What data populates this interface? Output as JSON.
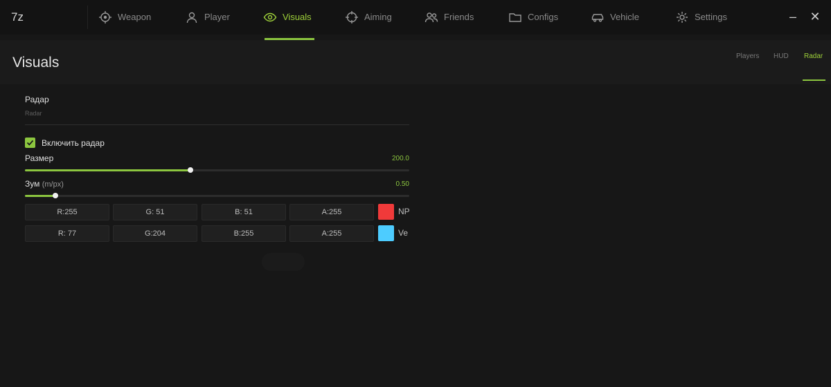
{
  "app": {
    "logo": "7z"
  },
  "nav": {
    "items": [
      {
        "label": "Weapon",
        "icon": "crosshair-target-icon"
      },
      {
        "label": "Player",
        "icon": "user-icon"
      },
      {
        "label": "Visuals",
        "icon": "eye-icon"
      },
      {
        "label": "Aiming",
        "icon": "crosshair-icon"
      },
      {
        "label": "Friends",
        "icon": "users-icon"
      },
      {
        "label": "Configs",
        "icon": "folder-icon"
      },
      {
        "label": "Vehicle",
        "icon": "car-icon"
      },
      {
        "label": "Settings",
        "icon": "gear-icon"
      }
    ],
    "active": "Visuals"
  },
  "window": {
    "minimize": "–",
    "close": "✕"
  },
  "page": {
    "title": "Visuals",
    "subtabs": [
      "Players",
      "HUD",
      "Radar"
    ],
    "active_subtab": "Radar"
  },
  "section": {
    "title": "Радар",
    "subtitle": "Radar",
    "enable_label": "Включить радар",
    "enabled": true
  },
  "size_slider": {
    "label": "Размер",
    "value_text": "200.0",
    "fill_fraction": 0.43
  },
  "zoom_slider": {
    "label": "Зум",
    "unit": "(m/px)",
    "value_text": "0.50",
    "fill_fraction": 0.08
  },
  "colors": [
    {
      "r": "R:255",
      "g": "G: 51",
      "b": "B: 51",
      "a": "A:255",
      "swatch": "#f03a3a",
      "label": "NP"
    },
    {
      "r": "R: 77",
      "g": "G:204",
      "b": "B:255",
      "a": "A:255",
      "swatch": "#4dccff",
      "label": "Ve"
    }
  ],
  "accent_color": "#8cc63f"
}
